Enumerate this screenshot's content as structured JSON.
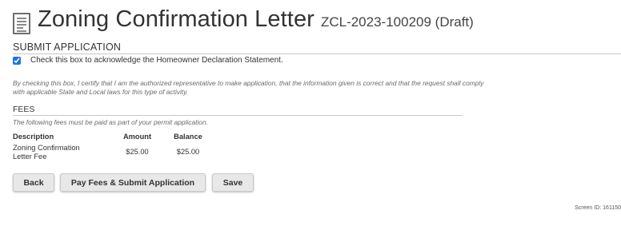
{
  "header": {
    "icon": "document-icon",
    "title": "Zoning Confirmation Letter",
    "subtitle": "ZCL-2023-100209 (Draft)"
  },
  "submit_section": {
    "heading": "SUBMIT APPLICATION",
    "acknowledge_checked": true,
    "acknowledge_label": "Check this box to acknowledge the Homeowner Declaration Statement.",
    "certify_text_line1": "By checking this box, I certify that I am the authorized representative to make application, that the information given is correct and that the request shall comply",
    "certify_text_line2": "with applicable State and Local laws for this type of activity."
  },
  "fees": {
    "heading": "FEES",
    "note": "The following fees must be paid as part of your permit application.",
    "columns": {
      "description": "Description",
      "amount": "Amount",
      "balance": "Balance"
    },
    "rows": [
      {
        "description_line1": "Zoning Confirmation",
        "description_line2": "Letter Fee",
        "amount": "$25.00",
        "balance": "$25.00"
      }
    ]
  },
  "buttons": {
    "back": "Back",
    "pay_submit": "Pay Fees & Submit Application",
    "save": "Save"
  },
  "footer": {
    "screen_id": "Screen ID: 161150"
  }
}
